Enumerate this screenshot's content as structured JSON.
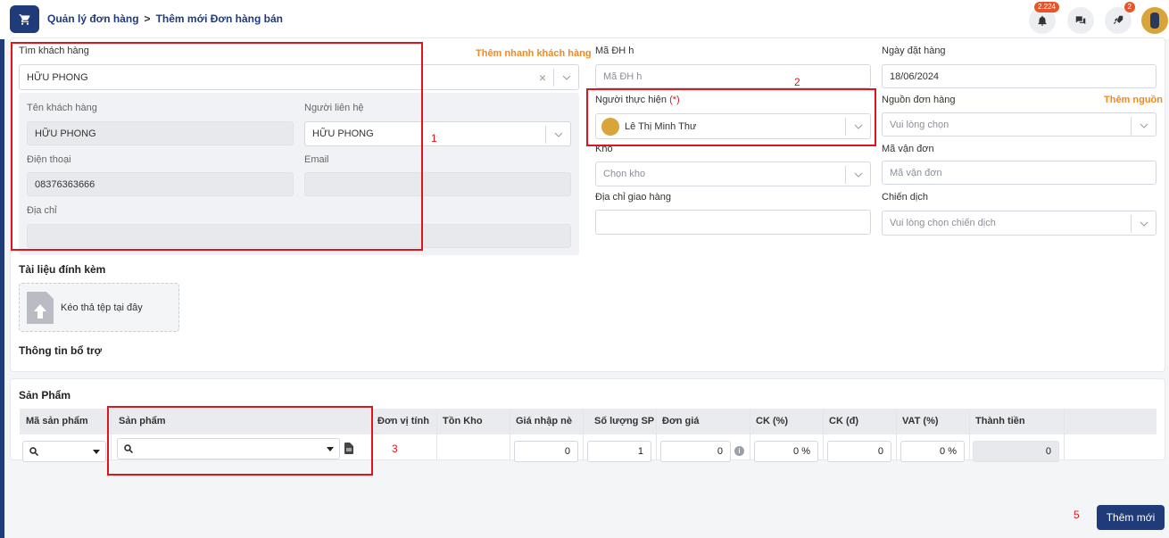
{
  "header": {
    "breadcrumb_parent": "Quản lý đơn hàng",
    "breadcrumb_sep": ">",
    "breadcrumb_current": "Thêm mới Đơn hàng bán",
    "notification_count": "2.224",
    "rocket_count": "2"
  },
  "customer": {
    "search_label": "Tìm khách hàng",
    "quick_add_label": "Thêm nhanh khách hàng",
    "search_value": "HỮU PHONG",
    "name_label": "Tên khách hàng",
    "name_value": "HỮU PHONG",
    "contact_label": "Người liên hệ",
    "contact_value": "HỮU PHONG",
    "phone_label": "Điện thoại",
    "phone_value": "08376363666",
    "email_label": "Email",
    "email_value": "",
    "address_label": "Địa chỉ",
    "address_value": ""
  },
  "order": {
    "code_label": "Mã ĐH h",
    "code_placeholder": "Mã ĐH h",
    "date_label": "Ngày đặt hàng",
    "date_value": "18/06/2024",
    "executor_label": "Người thực hiện",
    "required_mark": "(*)",
    "executor_value": "Lê Thị Minh Thư",
    "source_label": "Nguồn đơn hàng",
    "add_source_label": "Thêm nguồn",
    "source_placeholder": "Vui lòng chọn",
    "warehouse_label": "Kho",
    "warehouse_placeholder": "Chọn kho",
    "tracking_label": "Mã vận đơn",
    "tracking_placeholder": "Mã vận đơn",
    "shipping_label": "Địa chỉ giao hàng",
    "campaign_label": "Chiến dịch",
    "campaign_placeholder": "Vui lòng chọn chiến dịch"
  },
  "attachments": {
    "title": "Tài liệu đính kèm",
    "drop_text": "Kéo thả tệp tại đây"
  },
  "extra": {
    "title": "Thông tin bổ trợ"
  },
  "products": {
    "title": "Sản Phẩm",
    "columns": [
      "Mã sản phẩm",
      "Sản phẩm",
      "Đơn vị tính",
      "Tồn Kho",
      "Giá nhập nè",
      "Số lượng SP",
      "Đơn giá",
      "CK (%)",
      "CK (đ)",
      "VAT (%)",
      "Thành tiền"
    ],
    "row": {
      "import_price": "0",
      "quantity": "1",
      "unit_price": "0",
      "ck_pct": "0 %",
      "ck_amount": "0",
      "vat_pct": "0 %",
      "total": "0"
    }
  },
  "annotations": [
    "1",
    "2",
    "3",
    "5"
  ],
  "footer": {
    "submit_label": "Thêm mới"
  },
  "colors": {
    "primary": "#1f3b7a",
    "accent": "#f08a24",
    "annotation_red": "#e0141b"
  }
}
